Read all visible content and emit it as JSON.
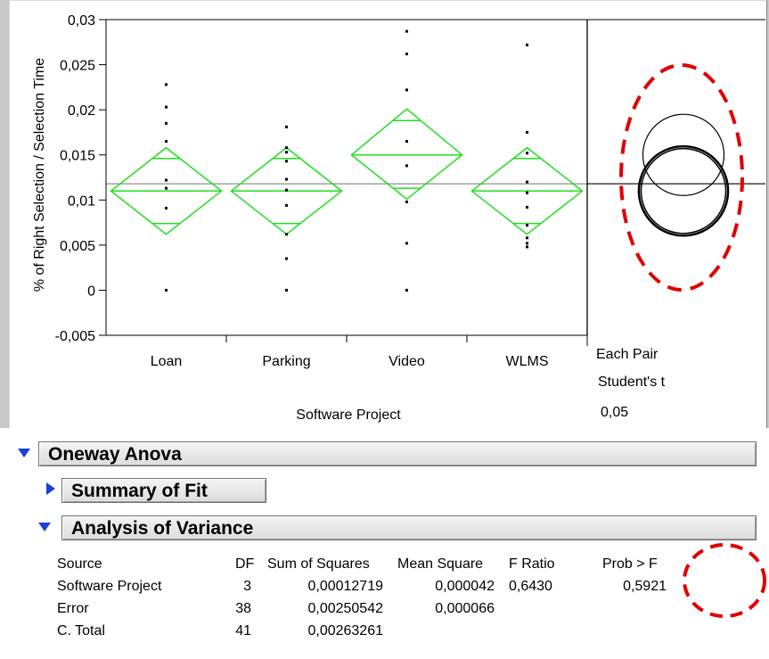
{
  "plot": {
    "y_axis_label": "% of Right Selection / Selection Time",
    "x_axis_label": "Software Project",
    "y_ticks": [
      "0,03",
      "0,025",
      "0,02",
      "0,015",
      "0,01",
      "0,005",
      "0",
      "-0,005"
    ],
    "comparison_label": [
      "Each Pair",
      "Student's t",
      "0,05"
    ]
  },
  "chart_data": {
    "type": "scatter",
    "xlabel": "Software Project",
    "ylabel": "% of Right Selection / Selection Time",
    "categories": [
      "Loan",
      "Parking",
      "Video",
      "WLMS"
    ],
    "ylim": [
      -0.005,
      0.03
    ],
    "grand_mean": 0.0118,
    "points": {
      "Loan": [
        0.0228,
        0.0203,
        0.0185,
        0.0165,
        0.0122,
        0.0113,
        0.0091,
        0.0
      ],
      "Parking": [
        0.0181,
        0.0158,
        0.0153,
        0.0143,
        0.0123,
        0.0111,
        0.0094,
        0.0062,
        0.0035,
        0.0
      ],
      "Video": [
        0.0287,
        0.0262,
        0.0222,
        0.0165,
        0.0138,
        0.0098,
        0.0052,
        0.0
      ],
      "WLMS": [
        0.0272,
        0.0175,
        0.0152,
        0.012,
        0.0108,
        0.0092,
        0.0072,
        0.0058,
        0.0052,
        0.0048
      ]
    },
    "means_diamonds": [
      {
        "category": "Loan",
        "mean": 0.011,
        "lower": 0.0062,
        "upper": 0.0158,
        "overlap_low": 0.0074,
        "overlap_high": 0.0146
      },
      {
        "category": "Parking",
        "mean": 0.011,
        "lower": 0.0062,
        "upper": 0.0158,
        "overlap_low": 0.0074,
        "overlap_high": 0.0146
      },
      {
        "category": "Video",
        "mean": 0.015,
        "lower": 0.0101,
        "upper": 0.0201,
        "overlap_low": 0.0113,
        "overlap_high": 0.0188
      },
      {
        "category": "WLMS",
        "mean": 0.011,
        "lower": 0.0062,
        "upper": 0.0158,
        "overlap_low": 0.0074,
        "overlap_high": 0.0146
      }
    ],
    "comparison_circles": [
      {
        "center": 0.015,
        "radius": 0.0045
      },
      {
        "center": 0.011,
        "radius": 0.0047
      },
      {
        "center": 0.011,
        "radius": 0.0049
      },
      {
        "center": 0.011,
        "radius": 0.005
      }
    ],
    "colors": {
      "diamond": "#22dd22",
      "annotation": "#e00000",
      "mean_line": "#a0a0a0"
    }
  },
  "report": {
    "oneway_title": "Oneway Anova",
    "summary_title": "Summary of Fit",
    "anova_title": "Analysis of Variance",
    "table_headers": [
      "Source",
      "DF",
      "Sum of Squares",
      "Mean Square",
      "F Ratio",
      "Prob > F"
    ],
    "table_rows": [
      [
        "Software Project",
        "3",
        "0,00012719",
        "0,000042",
        "0,6430",
        "0,5921"
      ],
      [
        "Error",
        "38",
        "0,00250542",
        "0,000066",
        "",
        ""
      ],
      [
        "C. Total",
        "41",
        "0,00263261",
        "",
        "",
        ""
      ]
    ]
  }
}
